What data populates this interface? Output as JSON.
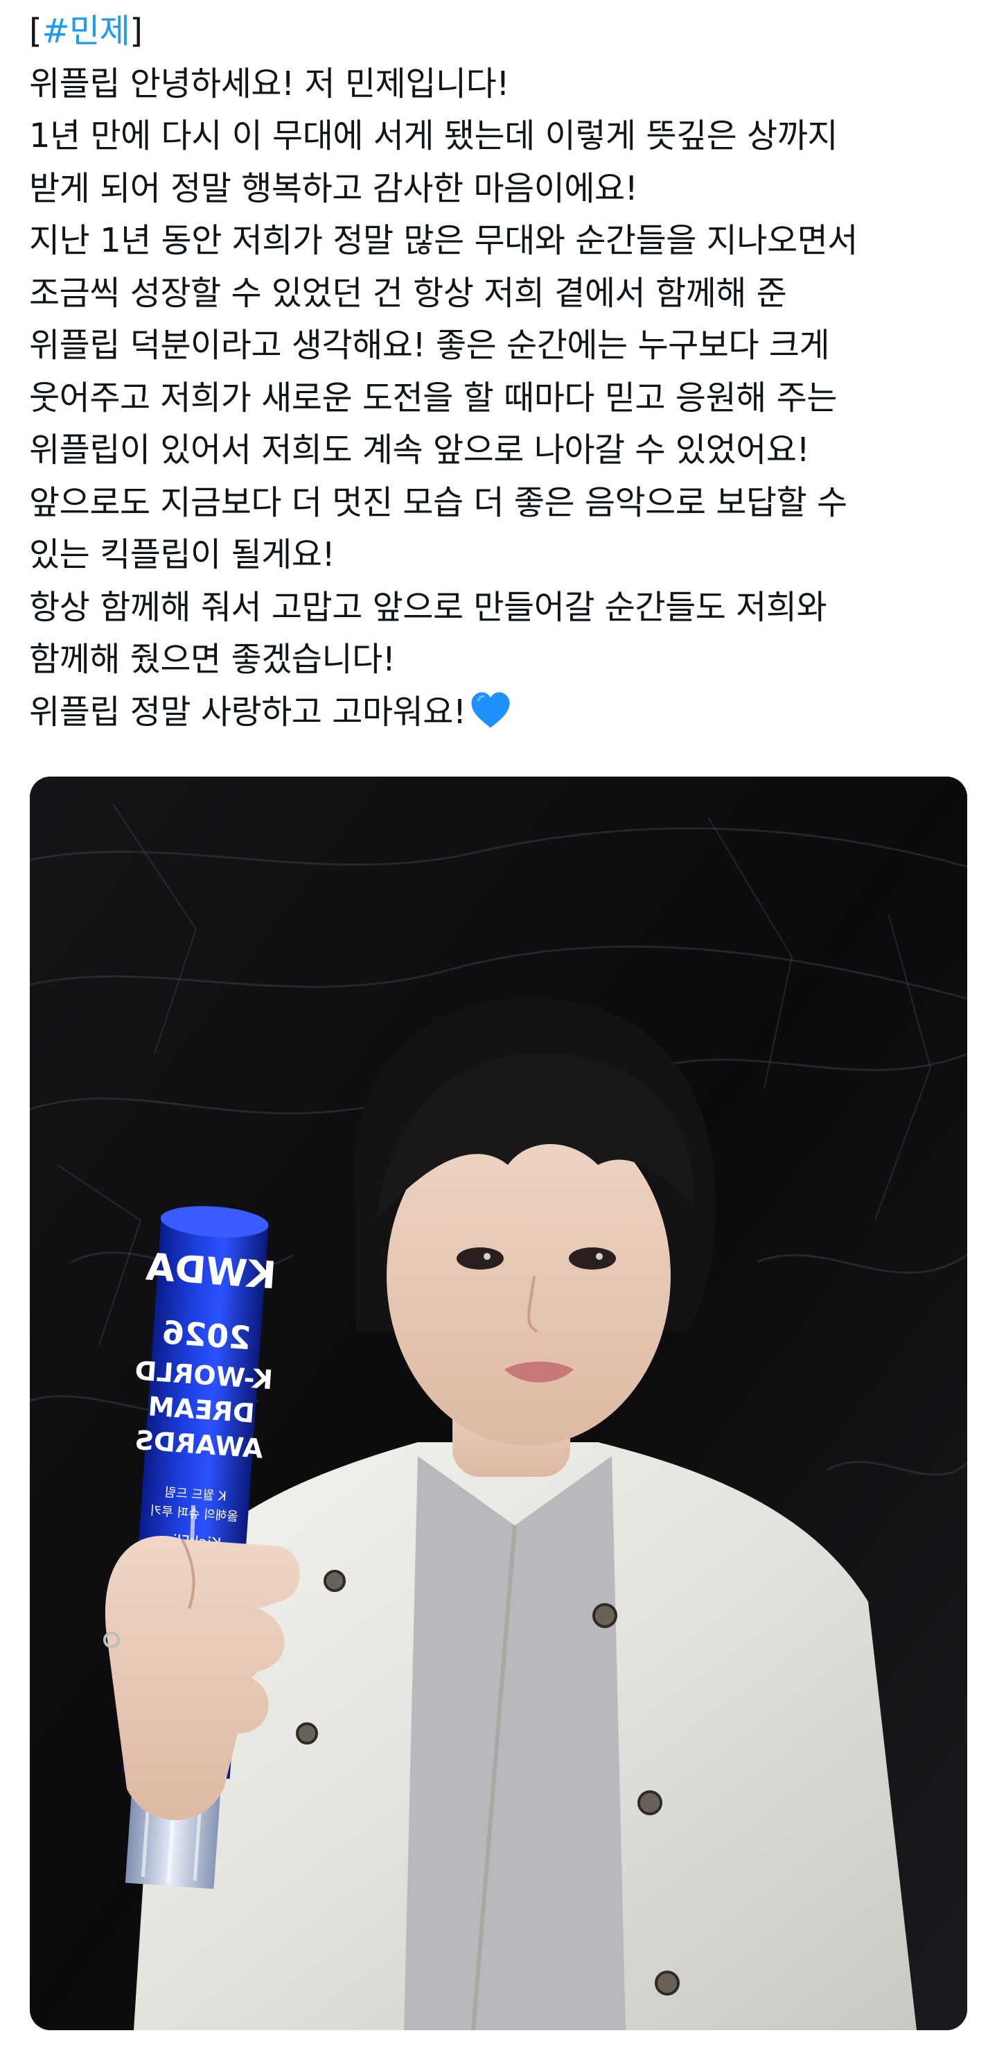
{
  "post": {
    "hashtag": {
      "open_bracket": "[",
      "tag": "#민제",
      "close_bracket": "]"
    },
    "lines": [
      "위플립 안녕하세요! 저 민제입니다!",
      "1년 만에 다시 이 무대에 서게 됐는데 이렇게 뜻깊은 상까지",
      "받게 되어 정말 행복하고 감사한 마음이에요!",
      "지난 1년 동안 저희가 정말 많은 무대와 순간들을 지나오면서",
      "조금씩 성장할 수 있었던 건 항상 저희 곁에서 함께해 준",
      "위플립 덕분이라고 생각해요! 좋은 순간에는 누구보다 크게",
      "웃어주고 저희가 새로운 도전을 할 때마다 믿고 응원해 주는",
      "위플립이 있어서 저희도 계속 앞으로 나아갈 수 있었어요!",
      "앞으로도 지금보다 더 멋진 모습 더 좋은 음악으로 보답할 수",
      "있는 킥플립이 될게요!",
      "항상 함께해 줘서 고맙고 앞으로 만들어갈 순간들도 저희와",
      "함께해 줬으면 좋겠습니다!"
    ],
    "last_line": "위플립 정말 사랑하고 고마워요!",
    "emoji": "blue-heart-icon",
    "colors": {
      "link": "#1d9bf0",
      "text": "#0f1419",
      "heart": "#1e90ff"
    }
  },
  "media": {
    "kind": "photo",
    "trophy_text": {
      "logo": "KWDA",
      "lines": [
        "2026",
        "K-WORLD",
        "DREAM",
        "AWARDS"
      ],
      "small_lines": [
        "K 월드 드림",
        "올해의 슈퍼 루키",
        "KickFlip"
      ]
    }
  }
}
